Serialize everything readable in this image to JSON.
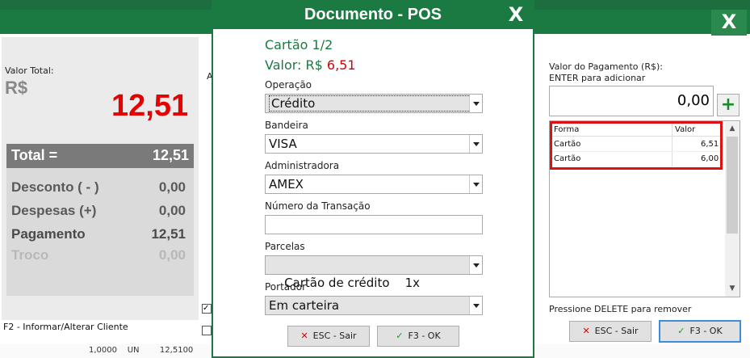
{
  "background": {
    "close_label": "X",
    "valor_total_label": "Valor Total:",
    "currency": "R$",
    "total_big": "12,51",
    "partial_letter": "A",
    "total_label": "Total =",
    "total_value": "12,51",
    "desconto_label": "Desconto ( - )",
    "desconto_value": "0,00",
    "despesas_label": "Despesas (+)",
    "despesas_value": "0,00",
    "pagamento_label": "Pagamento",
    "pagamento_value": "12,51",
    "troco_label": "Troco",
    "troco_value": "0,00",
    "f2_hint": "F2 - Informar/Alterar Cliente",
    "bottom_strip": "1,0000    UN        12,5100"
  },
  "dialog": {
    "title": "Documento - POS",
    "close_label": "X",
    "card_info": "Cartão 1/2",
    "valor_prefix": "Valor: R$",
    "valor_amount": "6,51",
    "operacao_label": "Operação",
    "operacao_value": "Crédito",
    "bandeira_label": "Bandeira",
    "bandeira_value": "VISA",
    "administradora_label": "Administradora",
    "administradora_value": "AMEX",
    "transacao_label": "Número da Transação",
    "transacao_value": "",
    "parcelas_label": "Parcelas",
    "parcelas_value": "Cartão de crédito    1x",
    "portador_label": "Portador",
    "portador_value": "Em carteira",
    "esc_label": "ESC - Sair",
    "ok_label": "F3 - OK"
  },
  "payment": {
    "header_line1": "Valor do Pagamento (R$):",
    "header_line2": "ENTER para adicionar",
    "input_value": "0,00",
    "plus_label": "+",
    "col_forma": "Forma",
    "col_valor": "Valor",
    "rows": [
      {
        "forma": "Cartão",
        "valor": "6,51"
      },
      {
        "forma": "Cartão",
        "valor": "6,00"
      }
    ],
    "delete_hint": "Pressione DELETE para remover",
    "esc_label": "ESC - Sair",
    "ok_label": "F3 - OK"
  },
  "colors": {
    "accent": "#1a7a42",
    "alert": "#d40000"
  }
}
